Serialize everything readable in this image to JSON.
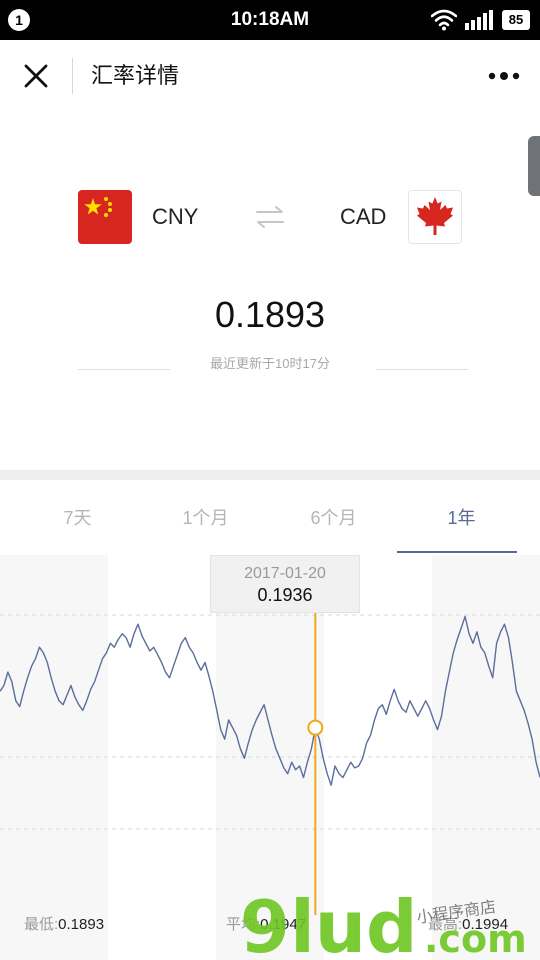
{
  "status_bar": {
    "notification_count": "1",
    "time": "10:18AM",
    "battery": "85",
    "icons": [
      "wifi-icon",
      "signal-icon",
      "battery-icon"
    ]
  },
  "nav": {
    "title": "汇率详情",
    "close_icon": "close-icon",
    "more_icon": "more-icon"
  },
  "conversion": {
    "from": {
      "code": "CNY",
      "flag_icon": "china-flag-icon"
    },
    "to": {
      "code": "CAD",
      "flag_icon": "canada-flag-icon"
    },
    "swap_icon": "swap-icon",
    "rate": "0.1893",
    "updated": "最近更新于10时17分"
  },
  "tabs": [
    {
      "label": "7天",
      "active": false
    },
    {
      "label": "1个月",
      "active": false
    },
    {
      "label": "6个月",
      "active": false
    },
    {
      "label": "1年",
      "active": true
    }
  ],
  "tooltip": {
    "date": "2017-01-20",
    "value": "0.1936"
  },
  "stats": {
    "low_label": "最低:",
    "low_value": "0.1893",
    "avg_label": "平均:",
    "avg_value": "0.1947",
    "high_label": "最高:",
    "high_value": "0.1994"
  },
  "watermark": {
    "brand": "9lud",
    "domain": ".com",
    "caption": "小程序商店"
  },
  "colors": {
    "accent": "#576b95",
    "line": "#5b6e9b",
    "cursor": "#f0a81c",
    "flag_red": "#d7261e",
    "flag_star": "#ffde00"
  },
  "chart_data": {
    "type": "line",
    "title": "",
    "xlabel": "",
    "ylabel": "",
    "range": "1年",
    "ylim": [
      0.188,
      0.2
    ],
    "grid": true,
    "series": [
      {
        "name": "",
        "values": [
          0.1955,
          0.1958,
          0.1965,
          0.196,
          0.195,
          0.1947,
          0.1955,
          0.1962,
          0.1968,
          0.1972,
          0.1978,
          0.1975,
          0.197,
          0.1962,
          0.1955,
          0.195,
          0.1948,
          0.1953,
          0.1958,
          0.1952,
          0.1948,
          0.1945,
          0.195,
          0.1956,
          0.196,
          0.1966,
          0.1972,
          0.1975,
          0.198,
          0.1978,
          0.1982,
          0.1985,
          0.1983,
          0.1978,
          0.1985,
          0.199,
          0.1984,
          0.198,
          0.1976,
          0.1978,
          0.1974,
          0.197,
          0.1965,
          0.1962,
          0.1968,
          0.1974,
          0.198,
          0.1983,
          0.1978,
          0.1975,
          0.197,
          0.1966,
          0.197,
          0.1963,
          0.1955,
          0.1945,
          0.1935,
          0.193,
          0.194,
          0.1936,
          0.1932,
          0.1925,
          0.192,
          0.1928,
          0.1935,
          0.194,
          0.1944,
          0.1948,
          0.194,
          0.1932,
          0.1925,
          0.192,
          0.1915,
          0.1912,
          0.1918,
          0.1914,
          0.1916,
          0.191,
          0.1918,
          0.1925,
          0.1936,
          0.193,
          0.192,
          0.1912,
          0.1906,
          0.1916,
          0.1912,
          0.191,
          0.1914,
          0.1918,
          0.1915,
          0.1916,
          0.192,
          0.1928,
          0.1932,
          0.194,
          0.1946,
          0.1948,
          0.1943,
          0.195,
          0.1956,
          0.195,
          0.1946,
          0.1944,
          0.195,
          0.1946,
          0.1942,
          0.1946,
          0.195,
          0.1946,
          0.194,
          0.1935,
          0.1942,
          0.1955,
          0.1965,
          0.1975,
          0.1982,
          0.1988,
          0.1994,
          0.1985,
          0.198,
          0.1986,
          0.1978,
          0.1975,
          0.1968,
          0.1962,
          0.198,
          0.1986,
          0.199,
          0.1983,
          0.197,
          0.1955,
          0.195,
          0.1945,
          0.1938,
          0.193,
          0.1918,
          0.191
        ]
      }
    ],
    "highlight": {
      "label": "2017-01-20",
      "value": 0.1936,
      "index": 80
    }
  }
}
